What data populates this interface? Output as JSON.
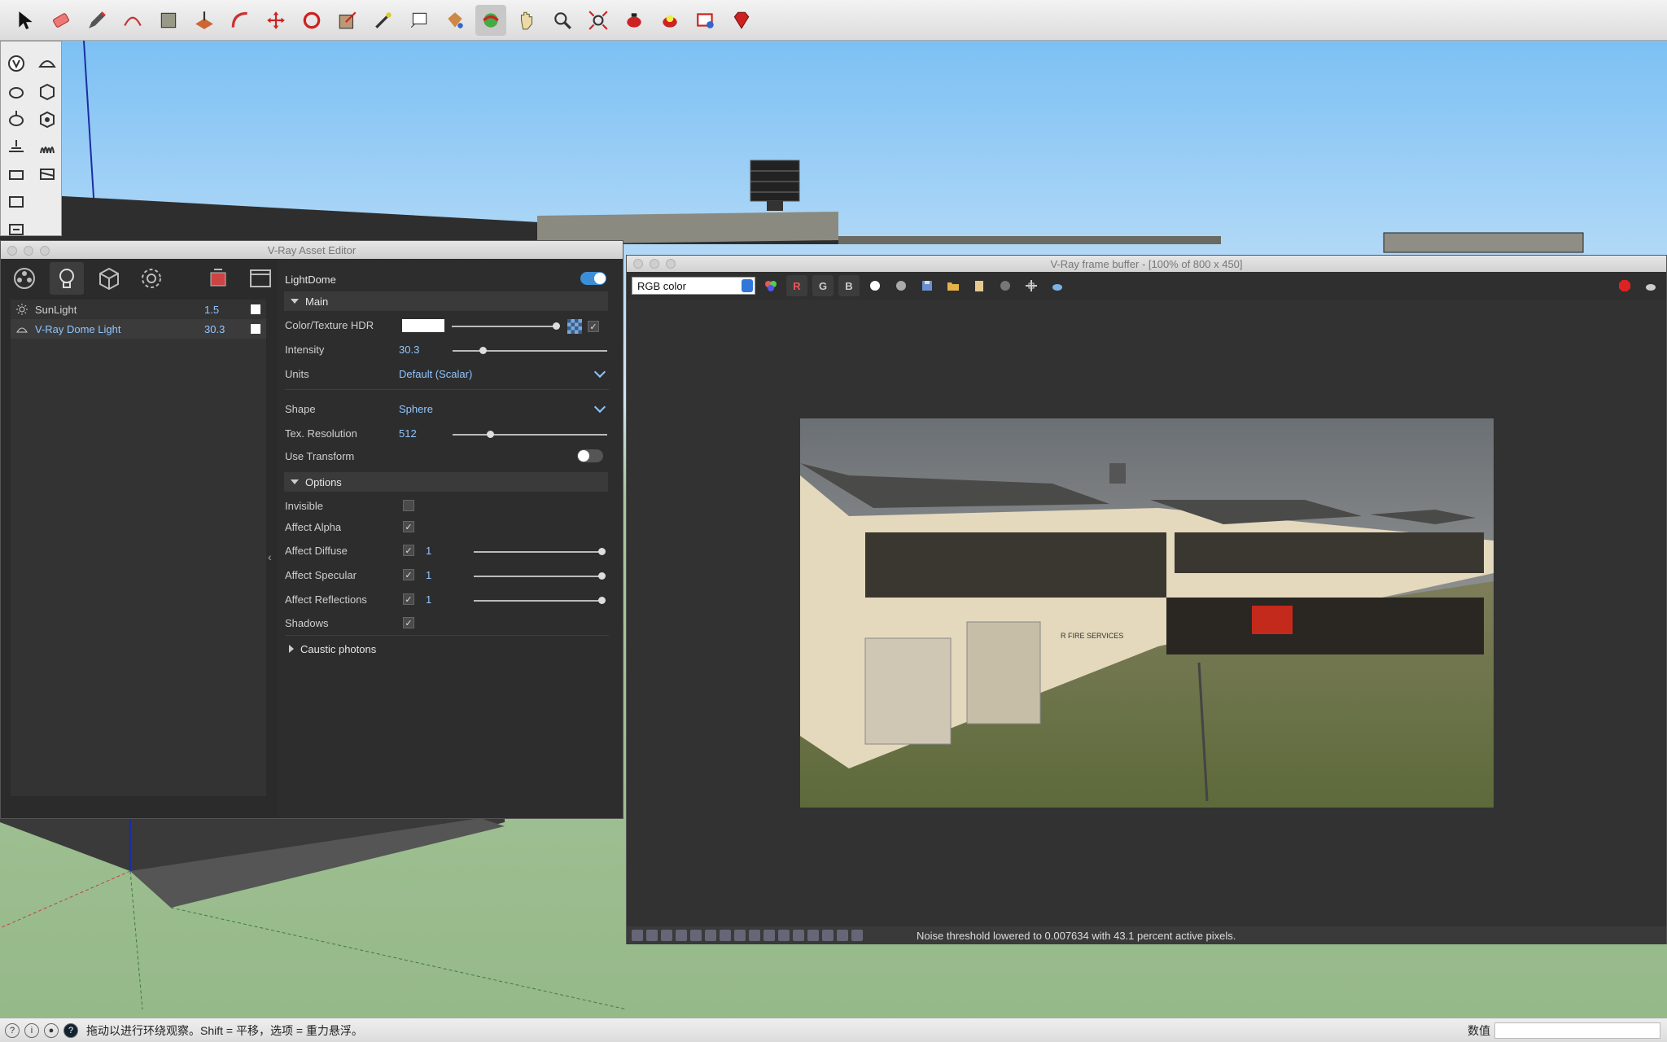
{
  "asset_editor": {
    "title": "V-Ray Asset Editor",
    "lights": [
      {
        "name": "SunLight",
        "value": "1.5"
      },
      {
        "name": "V-Ray Dome Light",
        "value": "30.3"
      }
    ],
    "panel": {
      "header": "LightDome",
      "main_section": "Main",
      "color_texture_label": "Color/Texture HDR",
      "intensity_label": "Intensity",
      "intensity_value": "30.3",
      "units_label": "Units",
      "units_value": "Default (Scalar)",
      "shape_label": "Shape",
      "shape_value": "Sphere",
      "tex_res_label": "Tex. Resolution",
      "tex_res_value": "512",
      "use_transform_label": "Use Transform",
      "options_section": "Options",
      "invisible_label": "Invisible",
      "affect_alpha_label": "Affect Alpha",
      "affect_diffuse_label": "Affect Diffuse",
      "affect_diffuse_value": "1",
      "affect_specular_label": "Affect Specular",
      "affect_specular_value": "1",
      "affect_reflections_label": "Affect Reflections",
      "affect_reflections_value": "1",
      "shadows_label": "Shadows",
      "caustic_section": "Caustic photons"
    }
  },
  "frame_buffer": {
    "title": "V-Ray frame buffer - [100% of 800 x 450]",
    "channel_select": "RGB color",
    "channel_buttons": [
      "R",
      "G",
      "B"
    ],
    "status_text": "Noise threshold lowered to 0.007634 with 43.1 percent active pixels.",
    "signage_text": "R FIRE SERVICES"
  },
  "status_bar": {
    "message": "拖动以进行环绕观察。Shift = 平移，选项 = 重力悬浮。",
    "measurement_label": "数值"
  },
  "colors": {
    "accent_blue": "#8fc6ff",
    "toggle_on": "#3c8fd6"
  }
}
